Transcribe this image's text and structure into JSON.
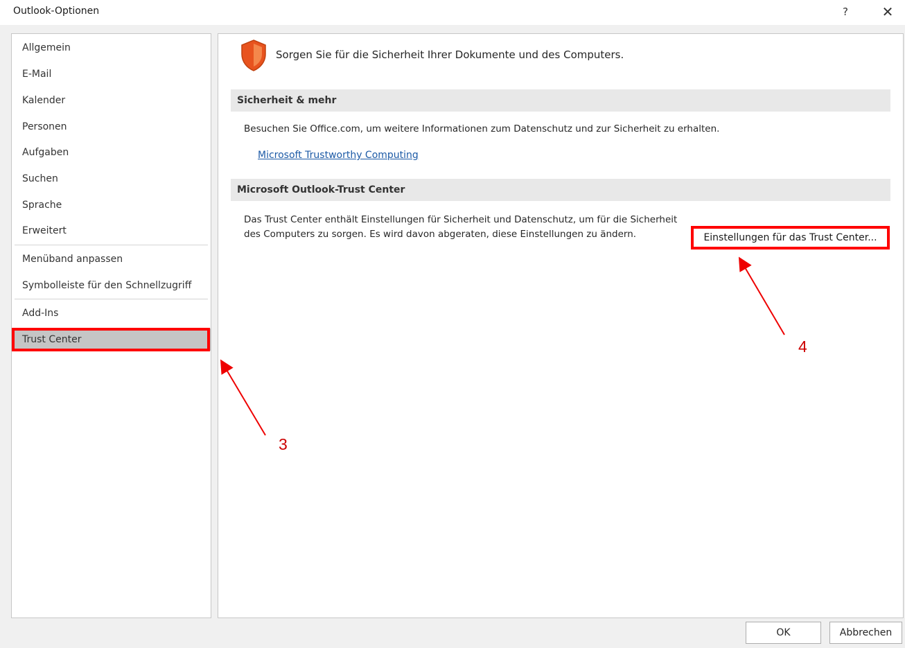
{
  "window": {
    "title": "Outlook-Optionen",
    "help_label": "?",
    "close_label": "✕"
  },
  "sidebar": {
    "items": [
      {
        "label": "Allgemein"
      },
      {
        "label": "E-Mail"
      },
      {
        "label": "Kalender"
      },
      {
        "label": "Personen"
      },
      {
        "label": "Aufgaben"
      },
      {
        "label": "Suchen"
      },
      {
        "label": "Sprache"
      },
      {
        "label": "Erweitert"
      },
      {
        "label": "Menüband anpassen"
      },
      {
        "label": "Symbolleiste für den Schnellzugriff"
      },
      {
        "label": "Add-Ins"
      },
      {
        "label": "Trust Center"
      }
    ],
    "selected": "Trust Center"
  },
  "main": {
    "headline": "Sorgen Sie für die Sicherheit Ihrer Dokumente und des Computers.",
    "security_section": {
      "header": "Sicherheit & mehr",
      "text": "Besuchen Sie Office.com, um weitere Informationen zum Datenschutz und zur Sicherheit zu erhalten.",
      "link": "Microsoft Trustworthy Computing"
    },
    "trust_section": {
      "header": "Microsoft Outlook-Trust Center",
      "text": "Das Trust Center enthält Einstellungen für Sicherheit und Datenschutz, um für die Sicherheit des Computers zu sorgen. Es wird davon abgeraten, diese Einstellungen zu ändern.",
      "button": "Einstellungen für das Trust Center..."
    }
  },
  "annotations": {
    "step3": "3",
    "step4": "4"
  },
  "footer": {
    "ok": "OK",
    "cancel": "Abbrechen"
  },
  "colors": {
    "highlight": "#ff0000",
    "link": "#1c5aa6",
    "shield": "#e8531e"
  },
  "icons": {
    "shield": "shield-icon",
    "help": "help-icon",
    "close": "close-icon"
  }
}
